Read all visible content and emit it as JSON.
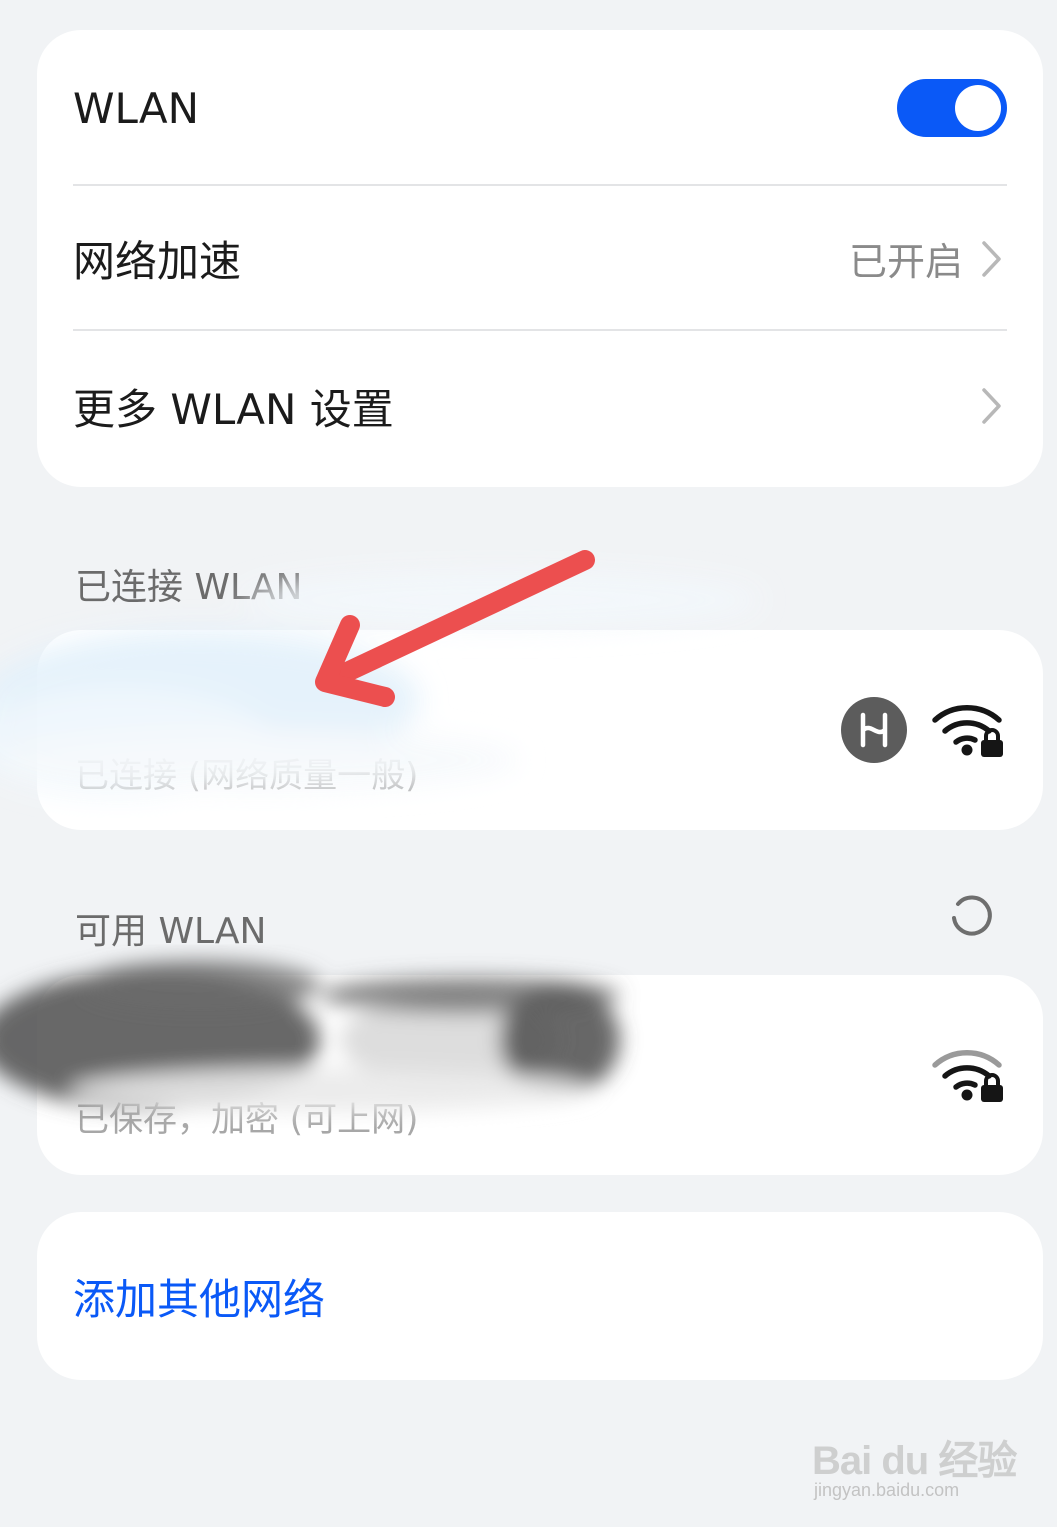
{
  "wlan_card": {
    "wlan_label": "WLAN",
    "wlan_toggle_on": true,
    "accel_label": "网络加速",
    "accel_value": "已开启",
    "more_label": "更多 WLAN 设置"
  },
  "connected_section": {
    "header": "已连接 WLAN",
    "network": {
      "status": "已连接 (网络质量一般)",
      "icons": [
        "hilink-badge-icon",
        "wifi-locked-icon"
      ]
    }
  },
  "available_section": {
    "header": "可用 WLAN",
    "refresh_icon": "refresh-icon",
    "network": {
      "status": "已保存，加密 (可上网)",
      "icons": [
        "wifi-locked-icon"
      ]
    }
  },
  "add_network": {
    "label": "添加其他网络"
  },
  "watermark": {
    "brand": "Bai du 经验",
    "url": "jingyan.baidu.com"
  },
  "colors": {
    "accent": "#0a59f7",
    "background": "#f1f3f5",
    "annotation_arrow": "#ec4f4f"
  }
}
